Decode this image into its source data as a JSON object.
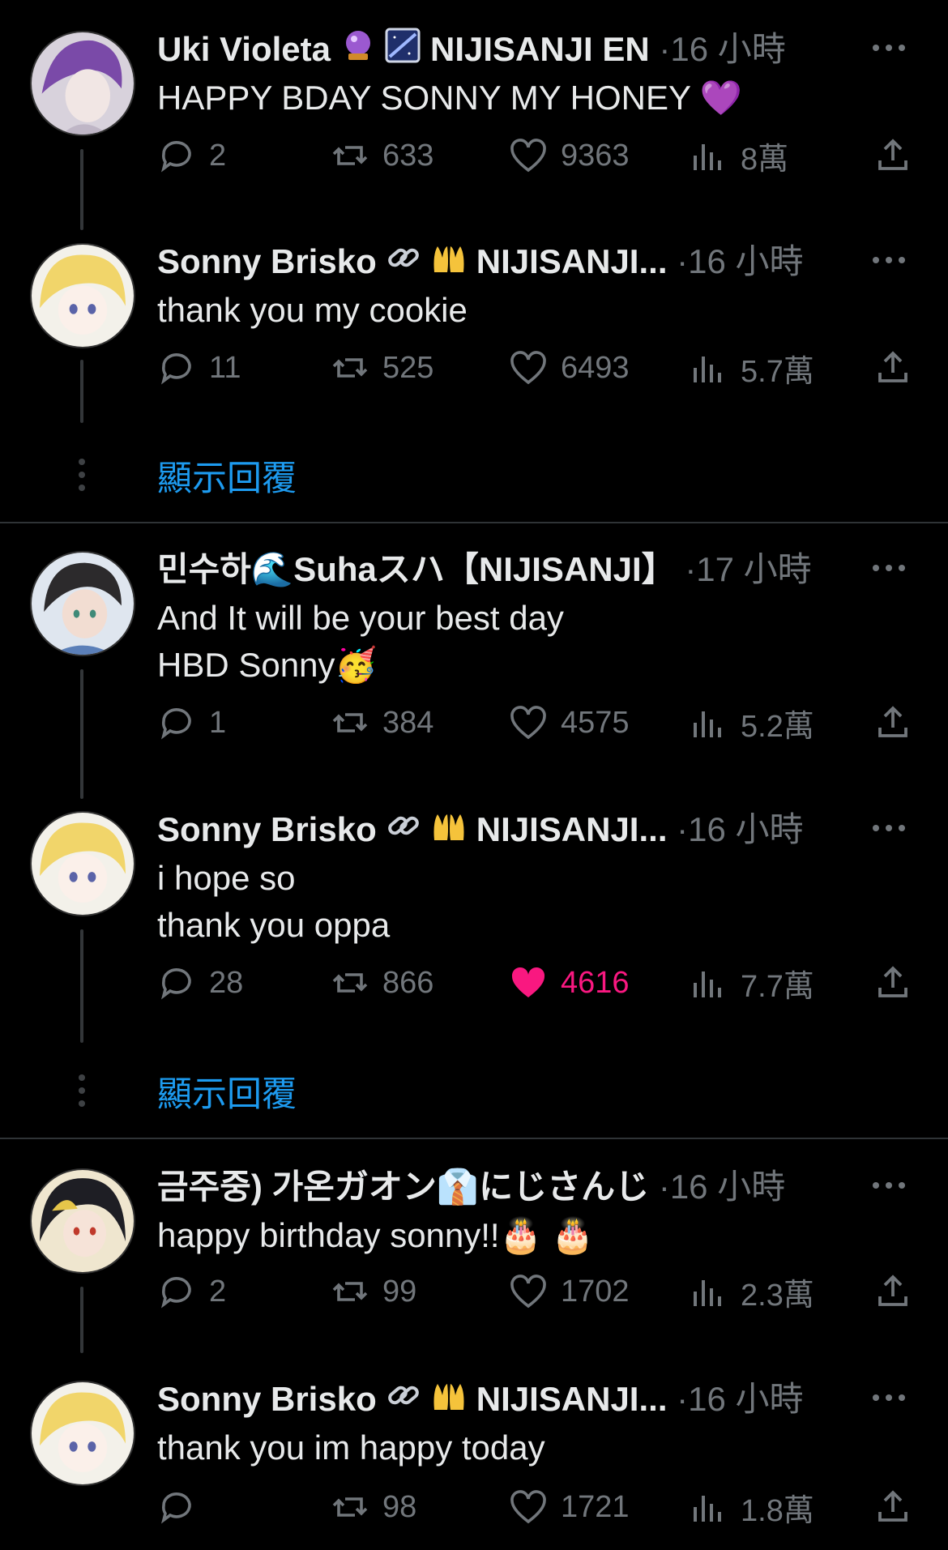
{
  "tweets": [
    {
      "name": "Uki Violeta",
      "badge": "NIJISANJI EN",
      "time": "·16 小時",
      "text": "HAPPY BDAY SONNY MY HONEY 💜",
      "replies": "2",
      "retweets": "633",
      "likes": "9363",
      "views": "8萬"
    },
    {
      "name": "Sonny Brisko",
      "badge": "NIJISANJI...",
      "time": "·16 小時",
      "text": "thank you my cookie",
      "replies": "11",
      "retweets": "525",
      "likes": "6493",
      "views": "5.7萬"
    },
    {
      "name": "민수하🌊Suhaスハ【NIJISANJI】",
      "badge": "",
      "time": "·17 小時",
      "text": "And It will be your best day\nHBD Sonny🥳",
      "replies": "1",
      "retweets": "384",
      "likes": "4575",
      "views": "5.2萬"
    },
    {
      "name": "Sonny Brisko",
      "badge": "NIJISANJI...",
      "time": "·16 小時",
      "text": "i hope so\nthank you oppa",
      "replies": "28",
      "retweets": "866",
      "likes": "4616",
      "views": "7.7萬"
    },
    {
      "name": "금주중) 가온ガオン👔にじさんじ",
      "badge": "",
      "time": "·16 小時",
      "text": "happy birthday sonny!!🎂 🎂",
      "replies": "2",
      "retweets": "99",
      "likes": "1702",
      "views": "2.3萬"
    },
    {
      "name": "Sonny Brisko",
      "badge": "NIJISANJI...",
      "time": "·16 小時",
      "text": "thank you im happy today",
      "replies": "",
      "retweets": "98",
      "likes": "1721",
      "views": "1.8萬"
    }
  ],
  "show_replies_label": "顯示回覆",
  "colors": {
    "background": "#000000",
    "text": "#e7e9ea",
    "muted": "#71767b",
    "link": "#1d9bf0",
    "like": "#f91880"
  }
}
